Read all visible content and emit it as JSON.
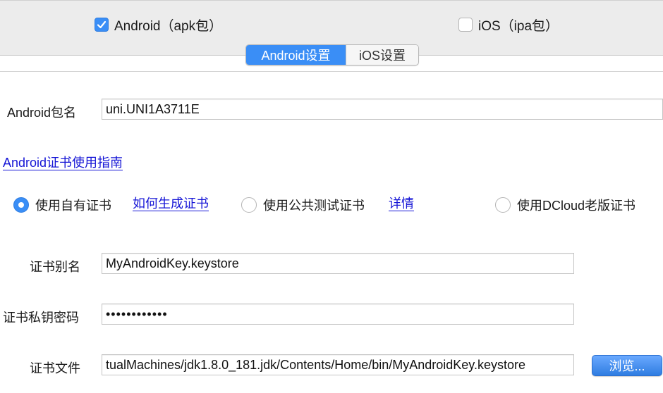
{
  "platforms": {
    "android": {
      "label": "Android（apk包）",
      "checked": true
    },
    "ios": {
      "label": "iOS（ipa包）",
      "checked": false
    }
  },
  "tabs": [
    {
      "label": "Android设置",
      "active": true
    },
    {
      "label": "iOS设置",
      "active": false
    }
  ],
  "package": {
    "label": "Android包名",
    "value": "uni.UNI1A3711E"
  },
  "cert_guide_link": "Android证书使用指南",
  "cert_options": {
    "own": {
      "label": "使用自有证书",
      "selected": true,
      "link": "如何生成证书"
    },
    "public": {
      "label": "使用公共测试证书",
      "selected": false,
      "link": "详情"
    },
    "dcloud": {
      "label": "使用DCloud老版证书",
      "selected": false
    }
  },
  "alias": {
    "label": "证书别名",
    "value": "MyAndroidKey.keystore"
  },
  "password": {
    "label": "证书私钥密码",
    "value": "••••••••••••"
  },
  "file": {
    "label": "证书文件",
    "value": "tualMachines/jdk1.8.0_181.jdk/Contents/Home/bin/MyAndroidKey.keystore",
    "browse_label": "浏览..."
  },
  "colors": {
    "accent": "#3a8ef6",
    "link": "#1515d6"
  },
  "icons": {
    "checkbox_check": "checkmark-icon",
    "radio_dot": "radio-dot-icon"
  }
}
